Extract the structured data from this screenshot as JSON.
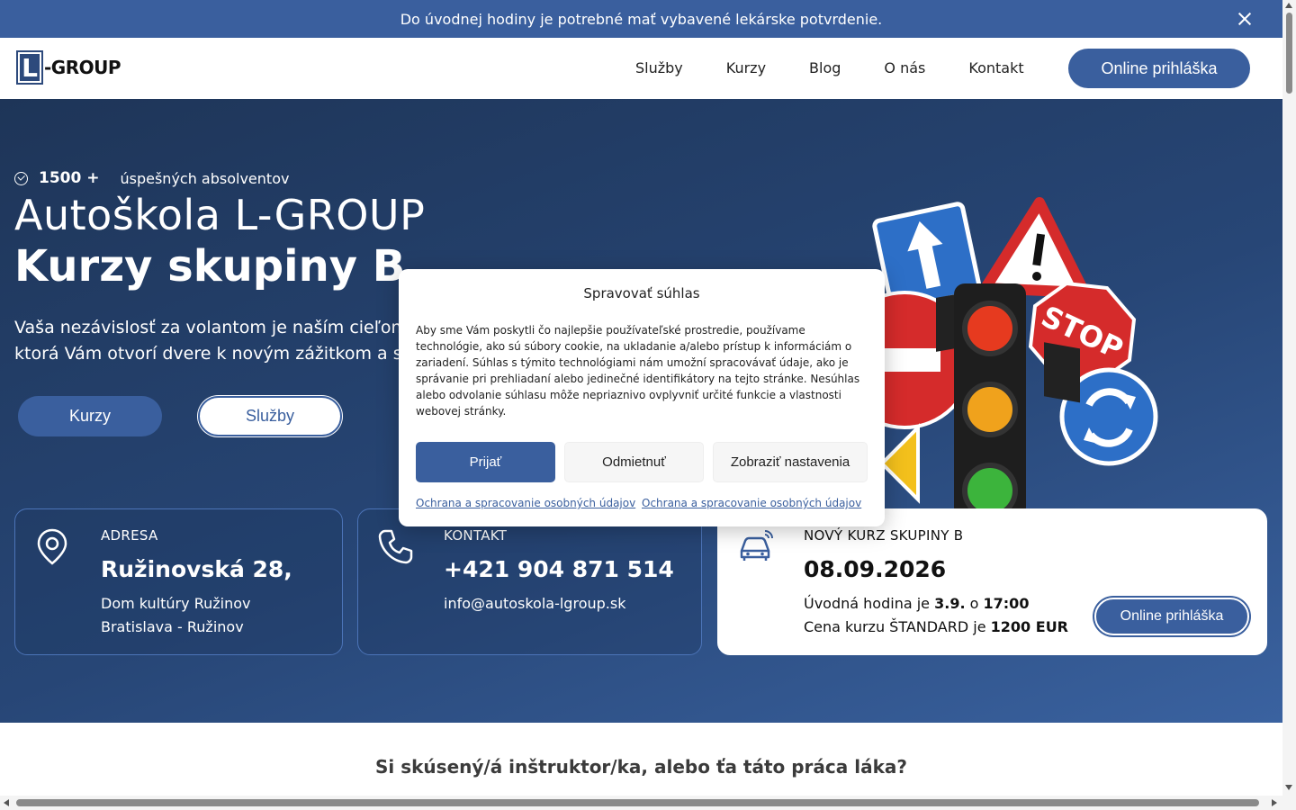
{
  "announcement": {
    "text": "Do úvodnej hodiny je potrebné mať vybavené lekárske potvrdenie."
  },
  "header": {
    "logo_letter": "L",
    "logo_text": "-GROUP",
    "nav": [
      "Služby",
      "Kurzy",
      "Blog",
      "O nás",
      "Kontakt"
    ],
    "cta": "Online prihláška"
  },
  "hero": {
    "badge_count": "1500 +",
    "badge_text": "úspešných absolventov",
    "title": "Autoškola L-GROUP",
    "subtitle": "Kurzy skupiny B",
    "text_line1": "Vaša nezávislosť za volantom je naším cieľom. Po",
    "text_line2": "ktorá Vám otvorí dvere k novým zážitkom a slobo",
    "btn_primary": "Kurzy",
    "btn_secondary": "Služby",
    "illustration_icons": [
      "traffic-light-icon",
      "stop-sign-icon",
      "warning-sign-icon",
      "roundabout-sign-icon",
      "arrow-up-sign-icon",
      "no-entry-sign-icon"
    ]
  },
  "cards": {
    "address": {
      "label": "ADRESA",
      "value": "Ružinovská 28,",
      "line1": "Dom kultúry Ružinov",
      "line2": "Bratislava - Ružinov"
    },
    "contact": {
      "label": "KONTAKT",
      "value": "+421 904 871 514",
      "line1": "info@autoskola-lgroup.sk"
    },
    "course": {
      "label": "NOVÝ KURZ SKUPINY B",
      "value": "08.09.2026",
      "intro_prefix": "Úvodná hodina je",
      "intro_date": "3.9.",
      "intro_mid": "o",
      "intro_time": "17:00",
      "price_prefix": "Cena kurzu ŠTANDARD je",
      "price": "1200 EUR",
      "cta": "Online prihláška"
    }
  },
  "section": {
    "title": "Si skúsený/á inštruktor/ka, alebo ťa táto práca láka?"
  },
  "consent": {
    "title": "Spravovať súhlas",
    "text": "Aby sme Vám poskytli čo najlepšie používateľské prostredie, používame technológie, ako sú súbory cookie, na ukladanie a/alebo prístup k informáciám o zariadení. Súhlas s týmito technológiami nám umožní spracovávať údaje, ako je správanie pri prehliadaní alebo jedinečné identifikátory na tejto stránke. Nesúhlas alebo odvolanie súhlasu môže nepriaznivo ovplyvniť určité funkcie a vlastnosti webovej stránky.",
    "accept": "Prijať",
    "deny": "Odmietnuť",
    "settings": "Zobraziť nastavenia",
    "link1": "Ochrana a spracovanie osobných údajov",
    "link2": "Ochrana a spracovanie osobných údajov"
  },
  "colors": {
    "brand": "#3a5f9e",
    "hero_dark": "#1e3558",
    "card_border": "#4c74b8"
  }
}
